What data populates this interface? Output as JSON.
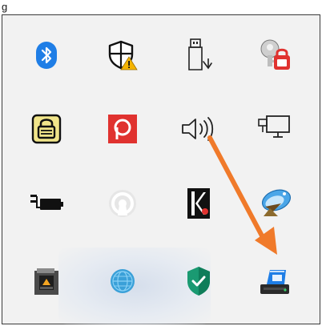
{
  "caption": "g",
  "accent": {
    "arrow": "#f07a2a",
    "bluetooth": "#1f7ee6",
    "red": "#e0322f",
    "shield_green": "#1a9a72"
  },
  "tray_icons": [
    {
      "name": "bluetooth-icon"
    },
    {
      "name": "windows-security-warning-icon"
    },
    {
      "name": "usb-safely-remove-icon"
    },
    {
      "name": "key-lock-icon"
    },
    {
      "name": "vpn-lock-icon"
    },
    {
      "name": "pushbullet-icon"
    },
    {
      "name": "volume-icon"
    },
    {
      "name": "network-icon"
    },
    {
      "name": "battery-charging-icon"
    },
    {
      "name": "openvpn-icon"
    },
    {
      "name": "app-k-icon"
    },
    {
      "name": "satellite-dish-icon"
    },
    {
      "name": "camera-app-icon"
    },
    {
      "name": "globe-app-icon"
    },
    {
      "name": "security-check-shield-icon"
    },
    {
      "name": "scanner-app-icon"
    }
  ]
}
